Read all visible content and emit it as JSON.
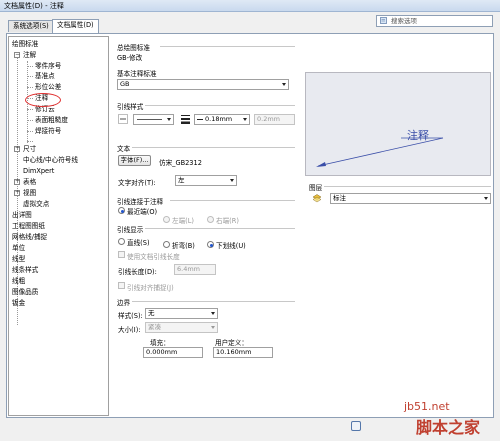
{
  "window": {
    "title": "文档属性(D) - 注释"
  },
  "tabs": [
    {
      "label": "系统选项(S)",
      "active": false
    },
    {
      "label": "文档属性(D)",
      "active": true
    }
  ],
  "search": {
    "placeholder": "搜索选项"
  },
  "tree": {
    "items": [
      {
        "label": "绘图标准"
      },
      {
        "label": "注解"
      },
      {
        "label": "零件序号"
      },
      {
        "label": "基准点"
      },
      {
        "label": "形位公差"
      },
      {
        "label": "注释"
      },
      {
        "label": "修订云"
      },
      {
        "label": "表面粗糙度"
      },
      {
        "label": "焊接符号"
      },
      {
        "label": "尺寸"
      },
      {
        "label": "中心线/中心符号线"
      },
      {
        "label": "DimXpert"
      },
      {
        "label": "表格"
      },
      {
        "label": "视图"
      },
      {
        "label": "虚拟交点"
      },
      {
        "label": "出详图"
      },
      {
        "label": "工程图图纸"
      },
      {
        "label": "网格线/捕捉"
      },
      {
        "label": "单位"
      },
      {
        "label": "线型"
      },
      {
        "label": "线条样式"
      },
      {
        "label": "线粗"
      },
      {
        "label": "图像品质"
      },
      {
        "label": "钣金"
      }
    ]
  },
  "overall_standard": {
    "label": "总绘图标准",
    "value": "GB-修改"
  },
  "base_standard": {
    "label": "基本注释标准",
    "value": "GB"
  },
  "leader_style": {
    "label": "引线样式",
    "thickness": "0.18mm",
    "custom": "0.2mm"
  },
  "text": {
    "label": "文本",
    "font_button": "字体(F)...",
    "font_name": "仿宋_GB2312",
    "align_label": "文字对齐(T):",
    "align_value": "左"
  },
  "leader_anchor": {
    "label": "引线连接于注释",
    "options": [
      {
        "label": "最近端(O)",
        "selected": true,
        "enabled": true
      },
      {
        "label": "左端(L)",
        "selected": false,
        "enabled": false
      },
      {
        "label": "右端(R)",
        "selected": false,
        "enabled": false
      }
    ]
  },
  "leader_display": {
    "label": "引线显示",
    "options": [
      {
        "label": "直线(S)",
        "selected": false
      },
      {
        "label": "折弯(B)",
        "selected": false
      },
      {
        "label": "下划线(U)",
        "selected": true
      }
    ],
    "use_doc_length": "使用文档引线长度",
    "length_label": "引线长度(D):",
    "length_value": "6.4mm",
    "align_snap": "引线对齐捕捉(J)"
  },
  "border": {
    "label": "边界",
    "style_label": "样式(S):",
    "style_value": "无",
    "size_label": "大小(I):",
    "size_value": "紧凑",
    "fill_label": "填充：",
    "fill_value": "0.000mm",
    "user_label": "用户定义：",
    "user_value": "10.160mm"
  },
  "preview": {
    "note_text": "注释"
  },
  "layer": {
    "label": "图层",
    "value": "标注"
  },
  "watermark": {
    "line1": "jb51.net",
    "line2": "脚本之家"
  }
}
